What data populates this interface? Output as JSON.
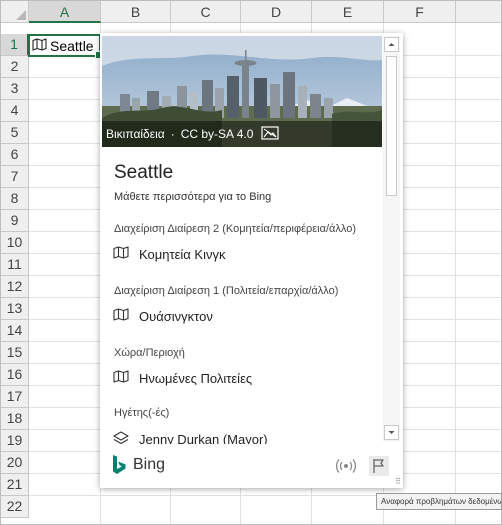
{
  "grid": {
    "columns": [
      "A",
      "B",
      "C",
      "D",
      "E",
      "F"
    ],
    "rows": [
      "1",
      "2",
      "3",
      "4",
      "5",
      "6",
      "7",
      "8",
      "9",
      "10",
      "11",
      "12",
      "13",
      "14",
      "15",
      "16",
      "17",
      "18",
      "19",
      "20",
      "21",
      "22"
    ],
    "selected_column": "A",
    "selected_row": "1"
  },
  "cell_a1": {
    "value": "Seattle",
    "icon": "map-icon"
  },
  "card": {
    "image_source": "Βικιπαίδεια",
    "image_separator": "·",
    "image_license": "CC by-SA 4.0",
    "title": "Seattle",
    "learn_more": "Μάθετε περισσότερα για το Bing",
    "sections": [
      {
        "label": "Διαχείριση Διαίρεση 2 (Κομητεία/περιφέρεια/άλλο)",
        "value": "Κομητεία Κινγκ",
        "icon": "map-icon"
      },
      {
        "label": "Διαχείριση Διαίρεση 1 (Πολιτεία/επαρχία/άλλο)",
        "value": "Ουάσινγκτον",
        "icon": "map-icon"
      },
      {
        "label": "Χώρα/Περιοχή",
        "value": "Ηνωμένες Πολιτείες",
        "icon": "map-icon"
      },
      {
        "label": "Ηγέτης(-ές)",
        "value": "Jenny Durkan (Mayor)",
        "icon": "stack-icon"
      }
    ],
    "footer_brand": "Bing",
    "tooltip": "Αναφορά προβλημάτων δεδομένων"
  },
  "colors": {
    "accent": "#217346",
    "bing": "#008373"
  }
}
